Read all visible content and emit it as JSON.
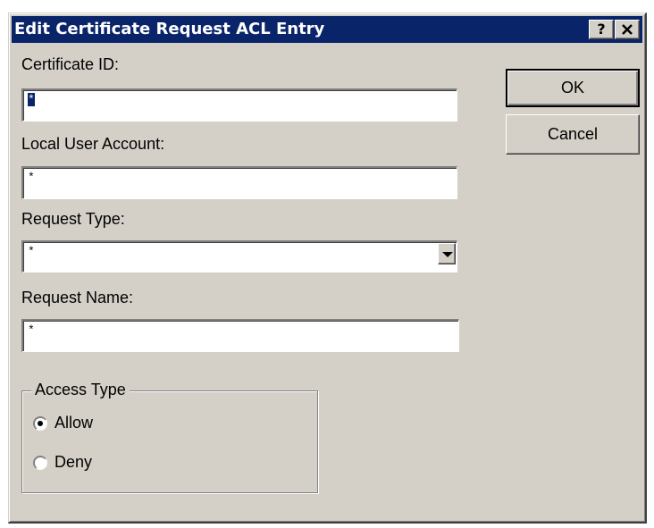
{
  "window": {
    "title": "Edit Certificate Request ACL Entry",
    "help_label": "?",
    "close_label": "✕"
  },
  "form": {
    "certificate_id": {
      "label": "Certificate ID:",
      "value": "*"
    },
    "local_user_account": {
      "label": "Local User Account:",
      "value": "*"
    },
    "request_type": {
      "label": "Request Type:",
      "value": "*"
    },
    "request_name": {
      "label": "Request Name:",
      "value": "*"
    }
  },
  "access_type": {
    "legend": "Access Type",
    "options": [
      {
        "label": "Allow",
        "selected": true
      },
      {
        "label": "Deny",
        "selected": false
      }
    ]
  },
  "buttons": {
    "ok": "OK",
    "cancel": "Cancel"
  },
  "colors": {
    "titlebar": "#0a246a",
    "dialog_face": "#d4d0c8",
    "selection": "#0a246a"
  }
}
